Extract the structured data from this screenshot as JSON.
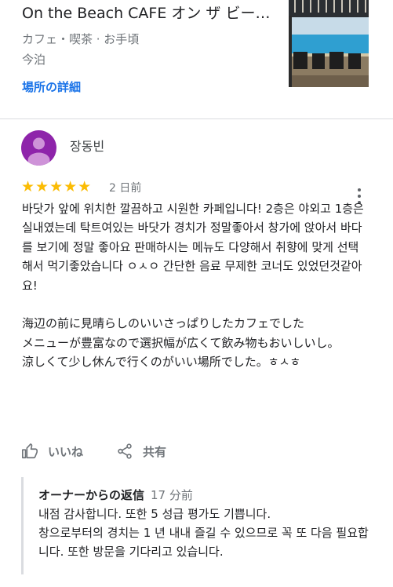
{
  "place": {
    "name": "On the Beach CAFE オン ザ ビー…",
    "category": "カフェ・喫茶 · お手頃",
    "hours": "今泊",
    "details_link": "場所の詳細"
  },
  "review": {
    "reviewer_name": "장동빈",
    "rating": 5,
    "stars": "★★★★★",
    "date": "2 日前",
    "body": "바닷가 앞에 위치한 깔끔하고 시원한 카페입니다! 2층은 야외고 1층은 실내였는데 탁트여있는 바닷가 경치가 정말좋아서 창가에 앉아서 바다를 보기에 정말 좋아요 판매하시는 메뉴도 다양해서 취향에 맞게 선택해서 먹기좋았습니다 ㅇㅅㅇ 간단한 음료 무제한 코너도 있었던것같아요!\n\n海辺の前に見晴らしのいいさっぱりしたカフェでした\nメニューが豊富なので選択幅が広くて飲み物もおいしいし。\n涼しくて少し休んで行くのがいい場所でした。ㅎㅅㅎ",
    "actions": {
      "like": "いいね",
      "share": "共有"
    }
  },
  "owner_reply": {
    "label": "オーナーからの返信",
    "time": "17 分前",
    "body": "내점 감사합니다. 또한 5 성급 평가도 기쁩니다.\n창으로부터의 경치는 1 년 내내 즐길 수 있으므로 꼭 또 다음 필요합니다. 또한 방문을 기다리고 있습니다."
  },
  "colors": {
    "link": "#1a73e8",
    "star": "#fbbc04",
    "avatar": "#8e24aa",
    "muted": "#70757a"
  },
  "icons": {
    "like": "thumb-up-icon",
    "share": "share-icon",
    "more": "more-vert-icon"
  }
}
